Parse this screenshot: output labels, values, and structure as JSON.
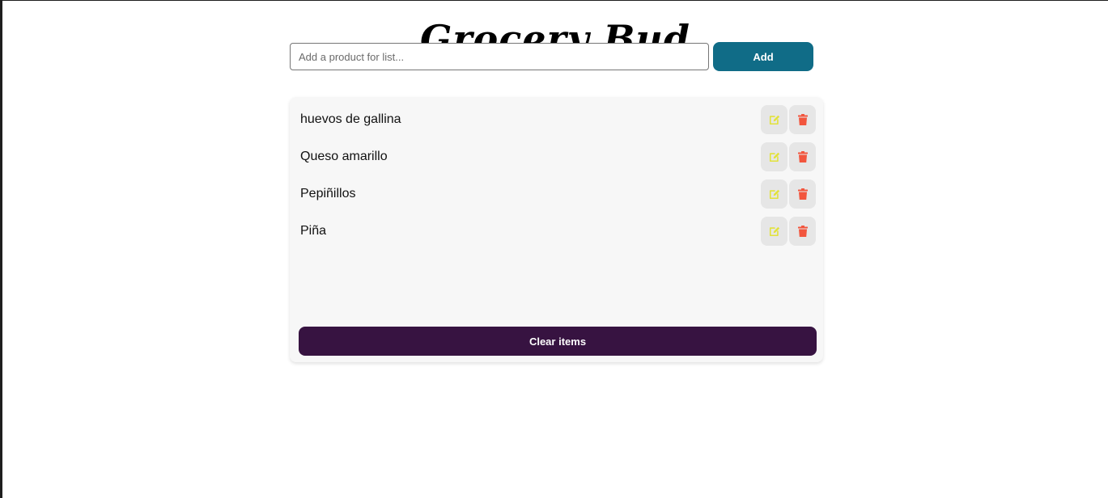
{
  "app": {
    "title": "Grocery Bud"
  },
  "form": {
    "placeholder": "Add a product for list...",
    "value": "",
    "add_label": "Add"
  },
  "list": {
    "items": [
      {
        "label": "huevos de gallina"
      },
      {
        "label": "Queso amarillo"
      },
      {
        "label": "Pepiñillos"
      },
      {
        "label": "Piña"
      }
    ],
    "item_icons": [
      "edit-icon",
      "trash-icon"
    ],
    "clear_label": "Clear items"
  },
  "colors": {
    "add_button": "#106c87",
    "clear_button": "#371341",
    "edit_icon": "#e2e23a",
    "delete_icon": "#f2553d",
    "card_background": "#f7f7f7"
  }
}
